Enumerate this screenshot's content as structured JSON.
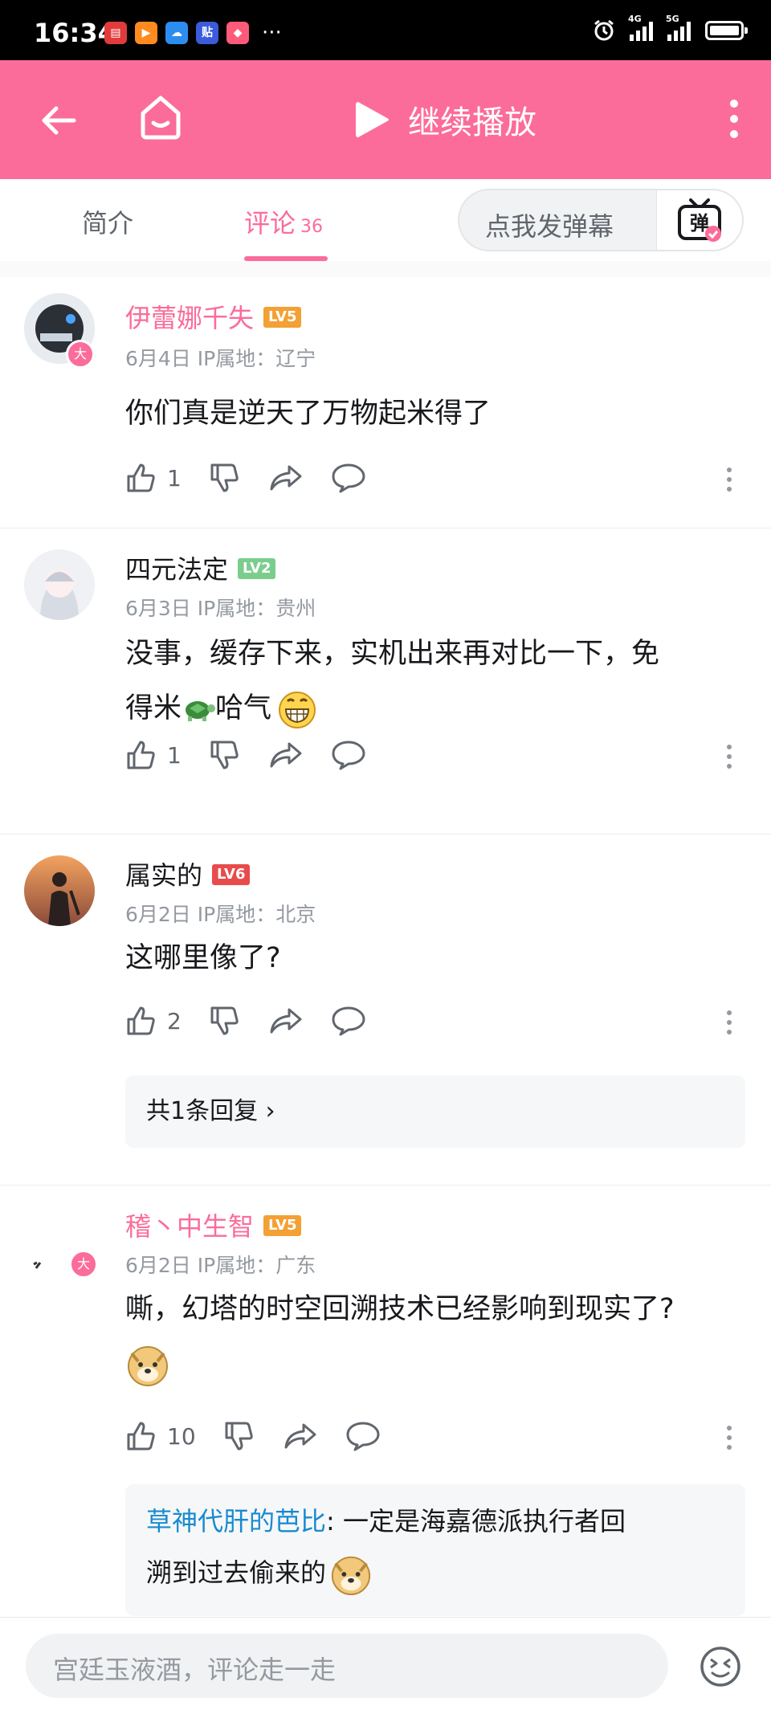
{
  "status_bar": {
    "time": "16:34",
    "dots": "···",
    "net1": "4G",
    "net2": "5G"
  },
  "header": {
    "title": "继续播放"
  },
  "tabs": [
    {
      "label": "简介"
    },
    {
      "label": "评论",
      "count": "36"
    }
  ],
  "danmaku": {
    "placeholder": "点我发弹幕",
    "button_glyph": "弹"
  },
  "comments": [
    {
      "user": "伊蕾娜千失",
      "level": "LV5",
      "date": "6月4日",
      "ip": "IP属地：辽宁",
      "text": "你们真是逆天了万物起米得了",
      "likes": "1",
      "badge": "大"
    },
    {
      "user": "四元法定",
      "level": "LV2",
      "date": "6月3日",
      "ip": "IP属地：贵州",
      "text1": "没事，缓存下来，实机出来再对比一下，免",
      "text2a": "得米",
      "text2b": "哈气",
      "likes": "1"
    },
    {
      "user": "属实的",
      "level": "LV6",
      "date": "6月2日",
      "ip": "IP属地：北京",
      "text": "这哪里像了?",
      "likes": "2",
      "reply_summary": "共1条回复 ›"
    },
    {
      "user": "稽丶中生智",
      "level": "LV5",
      "date": "6月2日",
      "ip": "IP属地：广东",
      "text": "嘶，幻塔的时空回溯技术已经影响到现实了?",
      "likes": "10",
      "badge": "大",
      "reply": {
        "user": "草神代肝的芭比",
        "text1": ": 一定是海嘉德派执行者回",
        "text2": "溯到过去偷来的"
      }
    }
  ],
  "comment_input": {
    "placeholder": "宫廷玉液酒，评论走一走"
  },
  "colors": {
    "brand": "#fb6c9a",
    "lv2": "#7bcd8d",
    "lv5": "#f3a034",
    "lv6": "#e84b4b",
    "link": "#178bcf",
    "text": "#18191c",
    "meta": "#9499a0"
  }
}
